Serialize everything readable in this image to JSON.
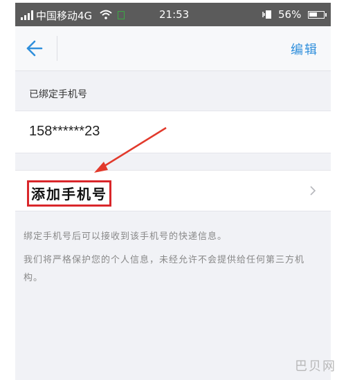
{
  "status_bar": {
    "carrier": "中国移动4G",
    "time": "21:53",
    "battery": "56%",
    "icons": [
      "signal-icon",
      "wifi-icon",
      "sim-icon",
      "vibrate-icon",
      "battery-icon"
    ]
  },
  "nav": {
    "back_icon": "back-arrow-icon",
    "edit_label": "编辑",
    "accent_color": "#2f8fdc"
  },
  "bound_section": {
    "label": "已绑定手机号",
    "phone": "158******23"
  },
  "add_phone": {
    "label": "添加手机号",
    "chevron_icon": "chevron-right-icon",
    "highlight_color": "#d9262a"
  },
  "info": {
    "line1": "绑定手机号后可以接收到该手机号的快递信息。",
    "line2": "我们将严格保护您的个人信息，未经允许不会提供给任何第三方机构。"
  },
  "watermark": "巴贝网"
}
